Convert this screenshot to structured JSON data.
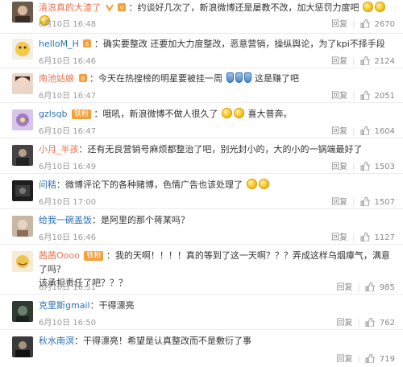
{
  "actions": {
    "reply": "回复"
  },
  "comments": [
    {
      "user": "清浪真的大渣了",
      "sep": "：",
      "text": "约谈好几次了，新浪微博还是屡教不改，加大惩罚力度吧",
      "time": "6月10日 16:48",
      "likes": "2670"
    },
    {
      "user": "helloM_H",
      "sep": "：",
      "text": "确实要整改 还要加大力度整改，恶意营销，操纵舆论，为了kpi不择手段",
      "time": "6月10日 16:46",
      "likes": "2124"
    },
    {
      "user": "南池姑娘",
      "sep": "：",
      "text": "今天在热搜榜的明星要被挂一周",
      "text2": "这是赚了吧",
      "time": "6月10日 16:47",
      "likes": "2051"
    },
    {
      "user": "gzlsqb",
      "badge": "铁粉",
      "sep": "：",
      "text": "哦吼，新浪微博不做人很久了",
      "text2": "喜大普奔。",
      "time": "6月10日 16:47",
      "likes": "1604"
    },
    {
      "user": "小月_半孩",
      "sep": "：",
      "text": "还有无良营销号麻烦都整治了吧，别光封小的，大的小的一锅端最好了",
      "time": "6月10日 16:49",
      "likes": "1503"
    },
    {
      "user": "问秸",
      "sep": "：",
      "text": "微博评论下的各种赌博，色情广告也该处理了",
      "time": "6月10日 17:00",
      "likes": "1507"
    },
    {
      "user": "给我一碗盖饭",
      "sep": "：",
      "text": "是阿里的那个蒋某吗？",
      "time": "6月10日 16:46",
      "likes": "1127"
    },
    {
      "user": "茜茜Oooo",
      "badge": "铁粉",
      "sep": "：",
      "text": "我的天啊！！！！真的等到了这一天啊？？？弄成这样乌烟瘴气，满意了吗？",
      "text_line2": "该承担责任了吧？？？",
      "time": "6月10日 16:51",
      "likes": "985"
    },
    {
      "user": "克里斯gmail",
      "sep": "：",
      "text": "干得漂亮",
      "time": "6月10日 16:50",
      "likes": "762"
    },
    {
      "user": "秋水南溟",
      "sep": "：",
      "text": "干得漂亮！希望是认真整改而不是敷衍了事",
      "time": "",
      "likes": "719"
    }
  ]
}
